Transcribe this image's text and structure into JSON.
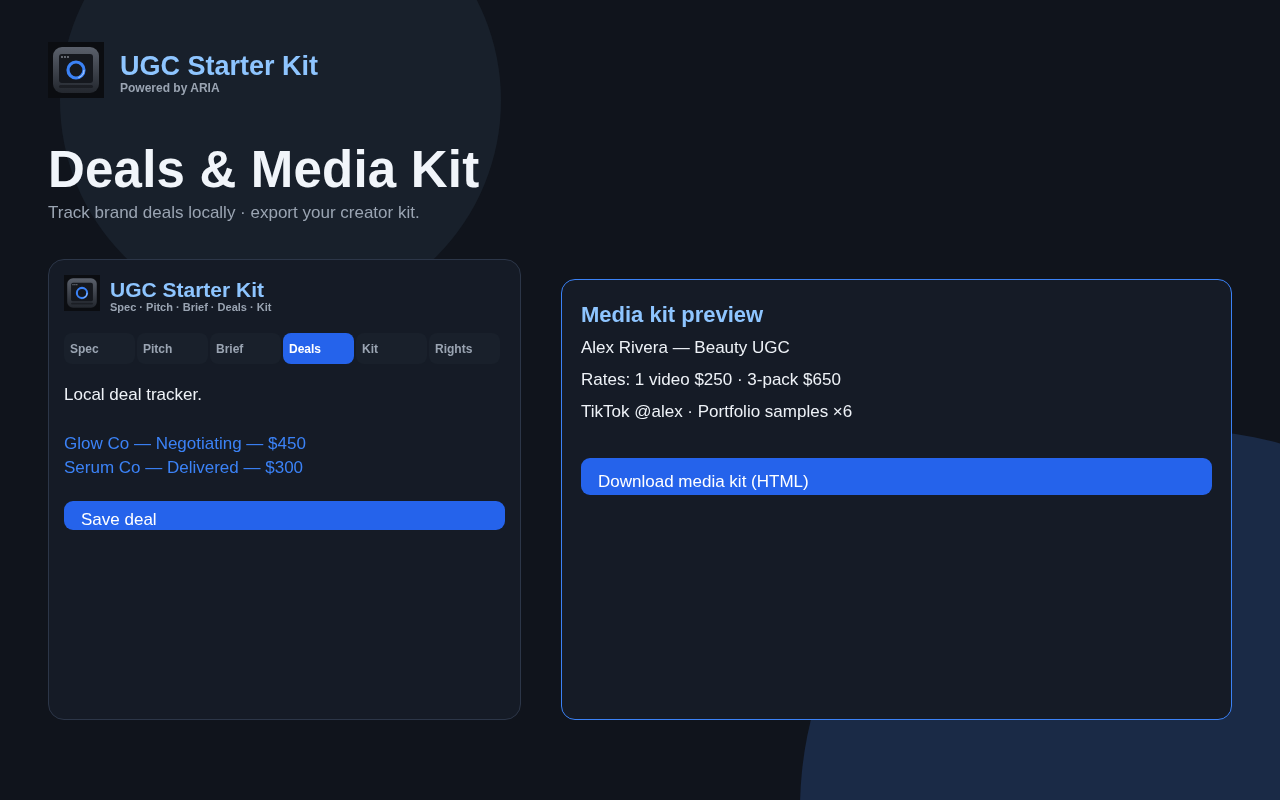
{
  "header": {
    "app_title": "UGC Starter Kit",
    "powered_by": "Powered by ARIA"
  },
  "page": {
    "title": "Deals & Media Kit",
    "subtitle": "Track brand deals locally · export your creator kit."
  },
  "deals_card": {
    "title": "UGC Starter Kit",
    "subtitle": "Spec · Pitch · Brief · Deals · Kit",
    "tabs": [
      {
        "label": "Spec",
        "selected": false
      },
      {
        "label": "Pitch",
        "selected": false
      },
      {
        "label": "Brief",
        "selected": false
      },
      {
        "label": "Deals",
        "selected": true
      },
      {
        "label": "Kit",
        "selected": false
      },
      {
        "label": "Rights",
        "selected": false
      }
    ],
    "description": "Local deal tracker.",
    "deals": [
      "Glow Co — Negotiating — $450",
      "Serum Co — Delivered — $300"
    ],
    "save_button": "Save deal"
  },
  "media_kit_preview": {
    "title": "Media kit preview",
    "lines": [
      "Alex Rivera — Beauty UGC",
      "Rates: 1 video $250 · 3-pack $650",
      "TikTok @alex · Portfolio samples ×6"
    ],
    "download_button": "Download media kit (HTML)"
  }
}
